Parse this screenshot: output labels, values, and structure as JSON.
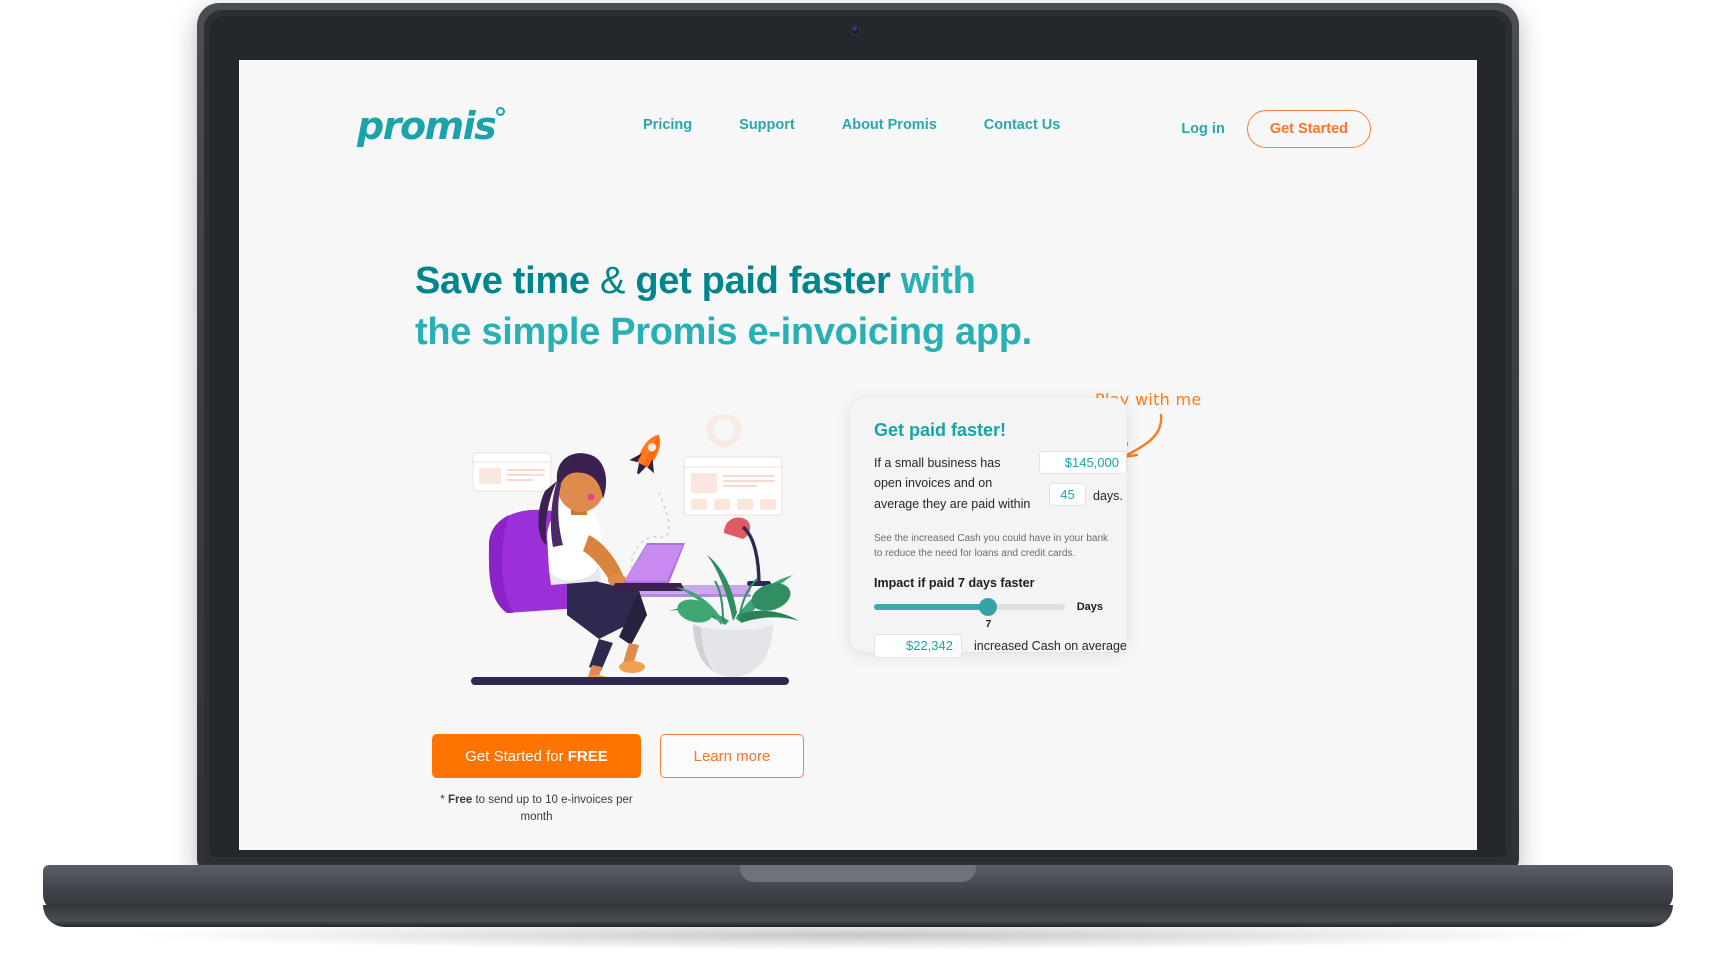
{
  "brand": {
    "logo_text": "promis",
    "teal": "#1ba3ac",
    "orange": "#ff7300"
  },
  "header": {
    "nav": [
      {
        "label": "Pricing"
      },
      {
        "label": "Support"
      },
      {
        "label": "About Promis"
      },
      {
        "label": "Contact Us"
      }
    ],
    "login_label": "Log in",
    "get_started_label": "Get Started"
  },
  "hero": {
    "title_bold_1": "Save time",
    "title_amp": " & ",
    "title_bold_2": "get paid faster",
    "title_rest": " with",
    "title_line2": "the simple Promis e-invoicing app.",
    "cta_primary_prefix": "Get Started for ",
    "cta_primary_strong": "FREE",
    "cta_secondary": "Learn more",
    "note_star": "* ",
    "note_strong": "Free",
    "note_rest": " to send up to 10 e-invoices per month"
  },
  "annotation": {
    "play_text": "Play with me"
  },
  "calculator": {
    "title": "Get paid faster!",
    "sentence_part1": "If a small business has",
    "sentence_part2": "open invoices and on",
    "sentence_part3": "average they are paid within",
    "amount_value": "$145,000",
    "amount_placeholder": "$145,000",
    "days_value": "45",
    "days_placeholder": "45",
    "days_suffix": "days.",
    "help_text": "See the increased Cash you could have in your bank to reduce the need for loans and credit cards.",
    "impact_label": "Impact if paid 7 days faster",
    "slider_value": "7",
    "slider_unit": "Days",
    "slider_percent": 60,
    "result_value": "$22,342",
    "result_placeholder": "$22,342",
    "result_label": "increased Cash on average"
  }
}
